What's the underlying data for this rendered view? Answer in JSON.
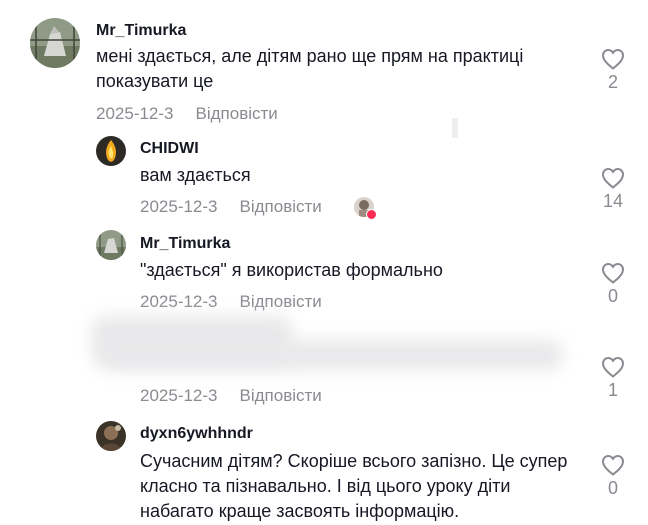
{
  "comments": [
    {
      "username": "Mr_Timurka",
      "text": "мені здається, але дітям рано ще прям на практиці показувати це",
      "date": "2025-12-3",
      "reply_label": "Відповісти",
      "likes": "2"
    },
    {
      "username": "CHIDWI",
      "text": "вам здається",
      "date": "2025-12-3",
      "reply_label": "Відповісти",
      "likes": "14"
    },
    {
      "username": "Mr_Timurka",
      "text": "\"здається\" я використав формально",
      "date": "2025-12-3",
      "reply_label": "Відповісти",
      "likes": "0"
    },
    {
      "username": "",
      "text": "",
      "date": "2025-12-3",
      "reply_label": "Відповісти",
      "likes": "1"
    },
    {
      "username": "dyxn6ywhhndr",
      "text": "Сучасним дітям? Скоріше всього запізно. Це супер класно та пізнавально. І від цього уроку діти набагато краще засвоять інформацію.",
      "date": "",
      "reply_label": "",
      "likes": "0"
    }
  ],
  "icons": {
    "like": "heart-outline-icon",
    "creator_liked": "heart-badge-icon"
  },
  "colors": {
    "text": "#161823",
    "muted": "#8a8b91",
    "accent": "#fe2c55"
  }
}
